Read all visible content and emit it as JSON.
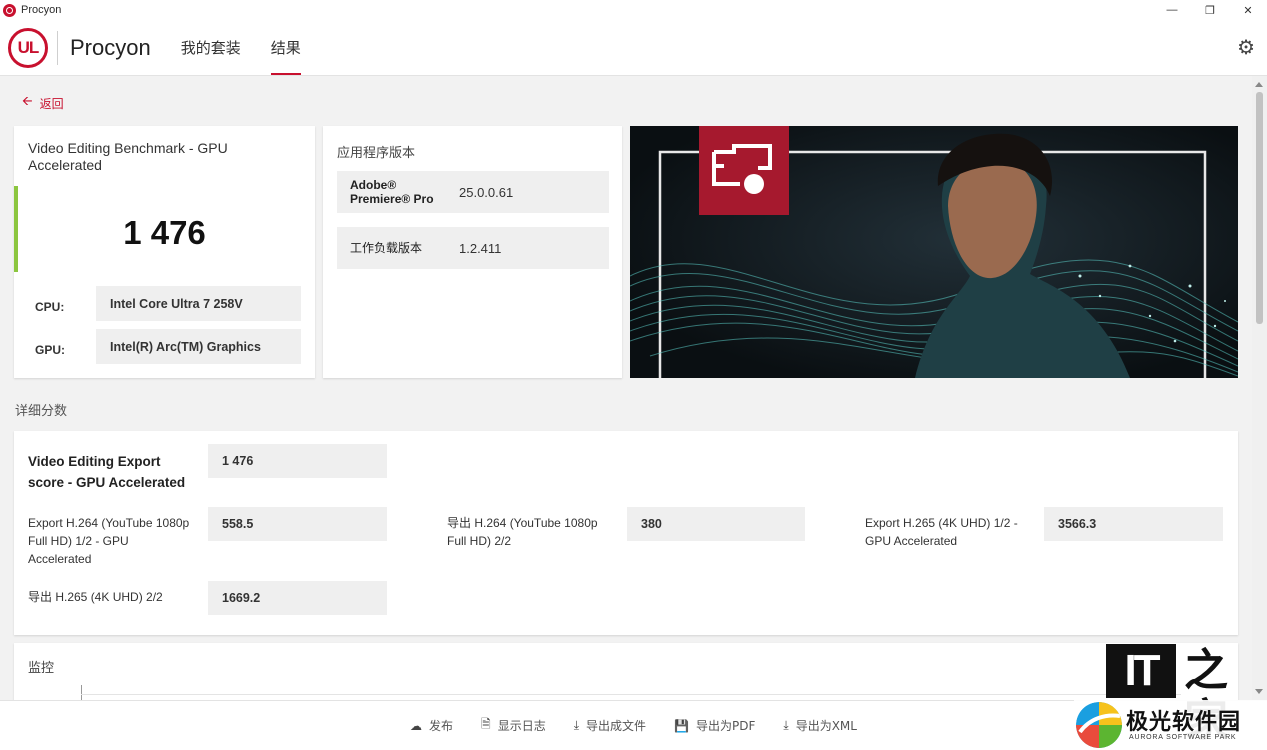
{
  "window": {
    "title": "Procyon"
  },
  "header": {
    "logo_text": "UL",
    "brand": "Procyon",
    "tabs": [
      {
        "label": "我的套装"
      },
      {
        "label": "结果"
      }
    ],
    "active_tab": 1
  },
  "back": {
    "label": "返回"
  },
  "score_card": {
    "title": "Video Editing Benchmark - GPU Accelerated",
    "score": "1 476",
    "cpu_label": "CPU:",
    "cpu_value": "Intel Core Ultra 7 258V",
    "gpu_label": "GPU:",
    "gpu_value": "Intel(R) Arc(TM) Graphics"
  },
  "versions": {
    "title": "应用程序版本",
    "rows": [
      {
        "name": "Adobe® Premiere® Pro",
        "value": "25.0.0.61"
      },
      {
        "name": "工作负载版本",
        "value": "1.2.411"
      }
    ]
  },
  "details": {
    "title": "详细分数",
    "main": {
      "label": "Video Editing Export score - GPU Accelerated",
      "value": "1 476"
    },
    "items": [
      {
        "label": "Export H.264 (YouTube 1080p Full HD) 1/2 - GPU Accelerated",
        "value": "558.5"
      },
      {
        "label": "导出 H.264 (YouTube 1080p Full HD) 2/2",
        "value": "380"
      },
      {
        "label": "Export H.265 (4K UHD) 1/2 - GPU Accelerated",
        "value": "3566.3"
      },
      {
        "label": "导出 H.265 (4K UHD) 2/2",
        "value": "1669.2"
      }
    ]
  },
  "monitor": {
    "title": "监控"
  },
  "actions": [
    {
      "label": "发布",
      "icon": "cloud-upload-icon"
    },
    {
      "label": "显示日志",
      "icon": "document-icon"
    },
    {
      "label": "导出成文件",
      "icon": "download-icon"
    },
    {
      "label": "导出为PDF",
      "icon": "save-icon"
    },
    {
      "label": "导出为XML",
      "icon": "download-icon"
    }
  ],
  "watermarks": {
    "ithome_latin": "IT",
    "ithome_cn": "之家",
    "aurora_cn": "极光软件园",
    "aurora_en": "AURORA SOFTWARE PARK"
  },
  "colors": {
    "brand_red": "#c8102e",
    "score_accent": "#8cc63f",
    "panel_gray": "#efefef"
  }
}
